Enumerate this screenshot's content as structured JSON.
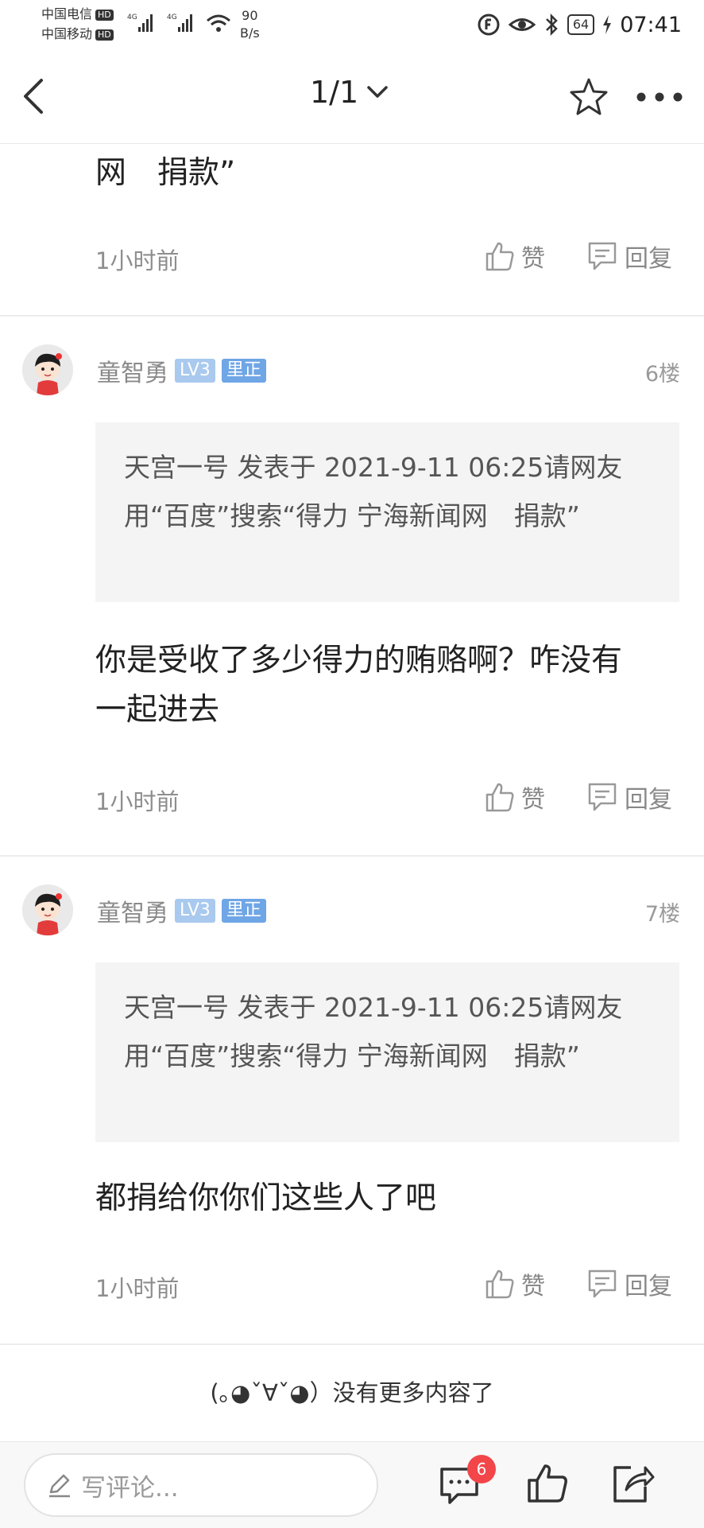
{
  "status_bar": {
    "carrier1": "中国电信",
    "carrier2": "中国移动",
    "hd": "HD",
    "net_type": "4G",
    "speed_value": "90",
    "speed_unit": "B/s",
    "battery": "64",
    "time": "07:41"
  },
  "nav": {
    "page_indicator": "1/1"
  },
  "comments": [
    {
      "tail_text": "网　捐款”",
      "time": "1小时前",
      "like_label": "赞",
      "reply_label": "回复"
    },
    {
      "username": "童智勇",
      "level": "LV3",
      "tag": "里正",
      "floor": "6楼",
      "quote": "天宫一号 发表于 2021-9-11 06:25请网友用“百度”搜索“得力 宁海新闻网　捐款”",
      "text": "你是受收了多少得力的贿赂啊？咋没有一起进去",
      "time": "1小时前",
      "like_label": "赞",
      "reply_label": "回复"
    },
    {
      "username": "童智勇",
      "level": "LV3",
      "tag": "里正",
      "floor": "7楼",
      "quote": "天宫一号 发表于 2021-9-11 06:25请网友用“百度”搜索“得力 宁海新闻网　捐款”",
      "text": "都捐给你你们这些人了吧",
      "time": "1小时前",
      "like_label": "赞",
      "reply_label": "回复"
    }
  ],
  "footer_note": "(｡◕ˇ∀ˇ◕）没有更多内容了",
  "bottom_bar": {
    "write_placeholder": "写评论...",
    "message_count": "6"
  },
  "colors": {
    "badge_level": "#a9c9ee",
    "badge_tag": "#6fa6e6",
    "notify_red": "#f2464a"
  },
  "icons": [
    "back-arrow-icon",
    "chevron-down-icon",
    "star-icon",
    "more-icon",
    "thumb-up-icon",
    "reply-icon",
    "pencil-icon",
    "comment-icon",
    "share-icon"
  ]
}
